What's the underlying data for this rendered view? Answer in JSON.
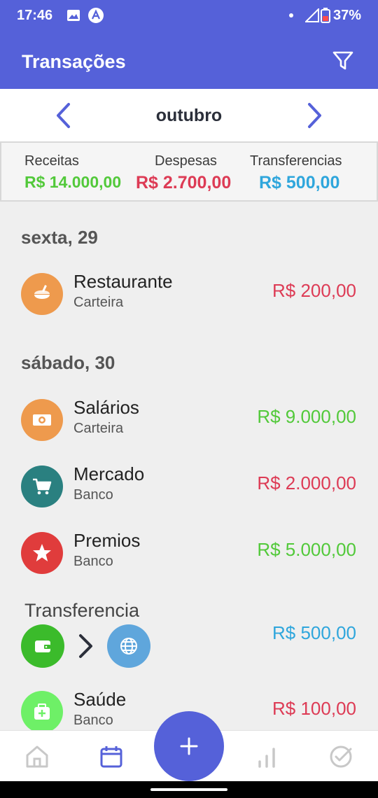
{
  "status_bar": {
    "time": "17:46",
    "battery": "37%"
  },
  "app_bar": {
    "title": "Transações"
  },
  "month": {
    "label": "outubro"
  },
  "summary": {
    "income_label": "Receitas",
    "income_value": "R$ 14.000,00",
    "expense_label": "Despesas",
    "expense_value": "R$ 2.700,00",
    "transfer_label": "Transferencias",
    "transfer_value": "R$ 500,00"
  },
  "days": [
    {
      "date": "sexta, 29",
      "items": [
        {
          "name": "Restaurante",
          "account": "Carteira",
          "amount": "R$ 200,00",
          "type": "expense",
          "icon": "food-icon",
          "color": "#ee9a4d"
        }
      ]
    },
    {
      "date": "sábado, 30",
      "items": [
        {
          "name": "Salários",
          "account": "Carteira",
          "amount": "R$ 9.000,00",
          "type": "income",
          "icon": "money-icon",
          "color": "#ee9a4d"
        },
        {
          "name": "Mercado",
          "account": "Banco",
          "amount": "R$ 2.000,00",
          "type": "expense",
          "icon": "cart-icon",
          "color": "#2a8080"
        },
        {
          "name": "Premios",
          "account": "Banco",
          "amount": "R$ 5.000,00",
          "type": "income",
          "icon": "star-icon",
          "color": "#e03c3c"
        }
      ],
      "transfer": {
        "title": "Transferencia",
        "amount": "R$ 500,00",
        "from_icon": "wallet-icon",
        "from_color": "#3bbb2b",
        "to_icon": "globe-icon",
        "to_color": "#5fa6dc"
      },
      "after_transfer": [
        {
          "name": "Saúde",
          "account": "Banco",
          "amount": "R$ 100,00",
          "type": "expense",
          "icon": "medkit-icon",
          "color": "#6ef067"
        }
      ]
    }
  ],
  "colors": {
    "primary": "#5561d9",
    "income": "#52c93a",
    "expense": "#dd3b55",
    "transfer": "#2fa6dc"
  },
  "bottom_nav": [
    "home-icon",
    "calendar-icon",
    "add-icon",
    "stats-icon",
    "check-icon"
  ]
}
